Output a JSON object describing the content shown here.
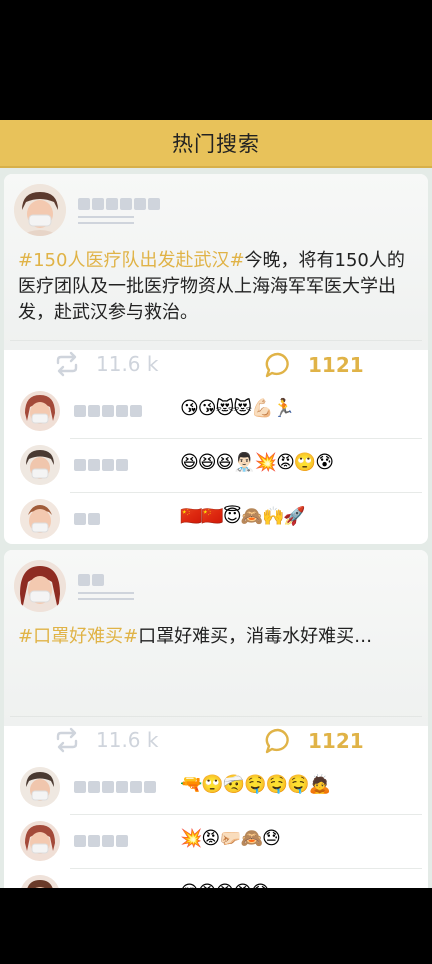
{
  "header": {
    "title": "热门搜索"
  },
  "posts": [
    {
      "hashtag": "#150人医疗队出发赴武汉#",
      "text": "今晚，将有150人的医疗团队及一批医疗物资从上海海军军医大学出发，赴武汉参与救治。",
      "repost_count": "11.6 k",
      "comment_count": "1121",
      "comments": [
        {
          "emojis": "😘😘😻😻💪🏻🏃"
        },
        {
          "emojis": "😆😆😆👨🏻‍⚕️💥😡🙄😰"
        },
        {
          "emojis": "🇨🇳🇨🇳😇🙈🙌🚀"
        }
      ]
    },
    {
      "hashtag": "#口罩好难买#",
      "text": "口罩好难买，消毒水好难买…",
      "repost_count": "11.6 k",
      "comment_count": "1121",
      "comments": [
        {
          "emojis": "🔫🙄🤕🤤🤤🤤🙇"
        },
        {
          "emojis": "💥😡🤛🏻🙈😓"
        },
        {
          "emojis": "😵😡😡😡😰"
        }
      ]
    }
  ],
  "icons": {
    "repost": "repost-icon",
    "comment": "comment-bubble-icon"
  },
  "colors": {
    "accent": "#e8c25a",
    "tag": "#e0b347",
    "placeholder": "#cfd4dc",
    "background": "#e4ebe7"
  }
}
